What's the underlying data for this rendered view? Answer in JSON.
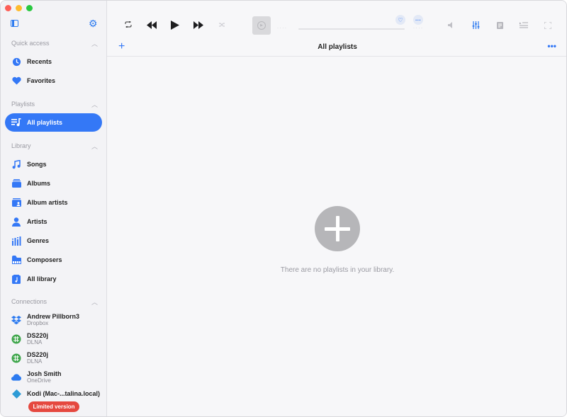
{
  "sidebar": {
    "quick_access": {
      "heading": "Quick access",
      "items": [
        {
          "label": "Recents",
          "icon": "clock-icon"
        },
        {
          "label": "Favorites",
          "icon": "heart-icon"
        }
      ]
    },
    "playlists": {
      "heading": "Playlists",
      "items": [
        {
          "label": "All playlists",
          "icon": "playlist-icon",
          "active": true
        }
      ]
    },
    "library": {
      "heading": "Library",
      "items": [
        {
          "label": "Songs",
          "icon": "music-note-icon"
        },
        {
          "label": "Albums",
          "icon": "album-stack-icon"
        },
        {
          "label": "Album artists",
          "icon": "album-artist-icon"
        },
        {
          "label": "Artists",
          "icon": "person-icon"
        },
        {
          "label": "Genres",
          "icon": "genres-icon"
        },
        {
          "label": "Composers",
          "icon": "piano-icon"
        },
        {
          "label": "All library",
          "icon": "library-book-icon"
        }
      ]
    },
    "connections": {
      "heading": "Connections",
      "items": [
        {
          "name": "Andrew Pillborn3",
          "service": "Dropbox",
          "icon": "dropbox-icon"
        },
        {
          "name": "DS220j",
          "service": "DLNA",
          "icon": "dlna-icon"
        },
        {
          "name": "DS220j",
          "service": "DLNA",
          "icon": "dlna-icon"
        },
        {
          "name": "Josh Smith",
          "service": "OneDrive",
          "icon": "onedrive-icon"
        },
        {
          "name": "Kodi (Mac-...talina.local)",
          "service": "",
          "icon": "kodi-icon"
        }
      ]
    },
    "limited_label": "Limited version"
  },
  "toolbar": {
    "buttons": [
      "repeat-icon",
      "rewind-icon",
      "play-icon",
      "fast-forward-icon",
      "shuffle-icon",
      "volume-icon",
      "equalizer-icon",
      "lyrics-icon",
      "queue-icon",
      "fullscreen-icon"
    ]
  },
  "header": {
    "title": "All playlists"
  },
  "content": {
    "empty_message": "There are no playlists in your library."
  },
  "colors": {
    "accent": "#3478f6",
    "limited_badge": "#e5483f",
    "empty_icon": "#b6b6b9"
  }
}
